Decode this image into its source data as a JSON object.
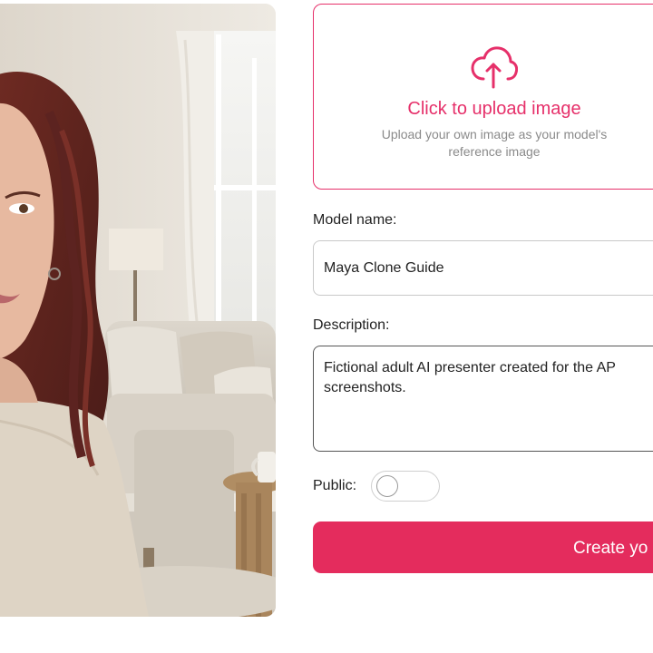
{
  "upload": {
    "icon": "cloud-upload-icon",
    "title": "Click to upload image",
    "subtitle_line1": "Upload your own image as your model's",
    "subtitle_line2": "reference image"
  },
  "form": {
    "model_name_label": "Model name:",
    "model_name_value": "Maya Clone Guide",
    "description_label": "Description:",
    "description_value": "Fictional adult AI presenter created for the AP\nscreenshots.",
    "public_label": "Public:",
    "public_enabled": false,
    "create_button_label": "Create yo"
  },
  "colors": {
    "accent": "#e6306a",
    "button": "#e42c5d"
  }
}
